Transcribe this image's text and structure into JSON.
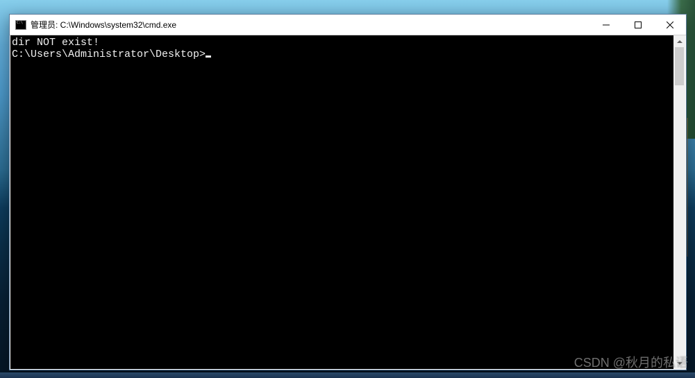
{
  "window": {
    "title": "管理员: C:\\Windows\\system32\\cmd.exe"
  },
  "terminal": {
    "lines": [
      "dir NOT exist!",
      "",
      "C:\\Users\\Administrator\\Desktop>"
    ]
  },
  "watermark": "CSDN @秋月的私语"
}
